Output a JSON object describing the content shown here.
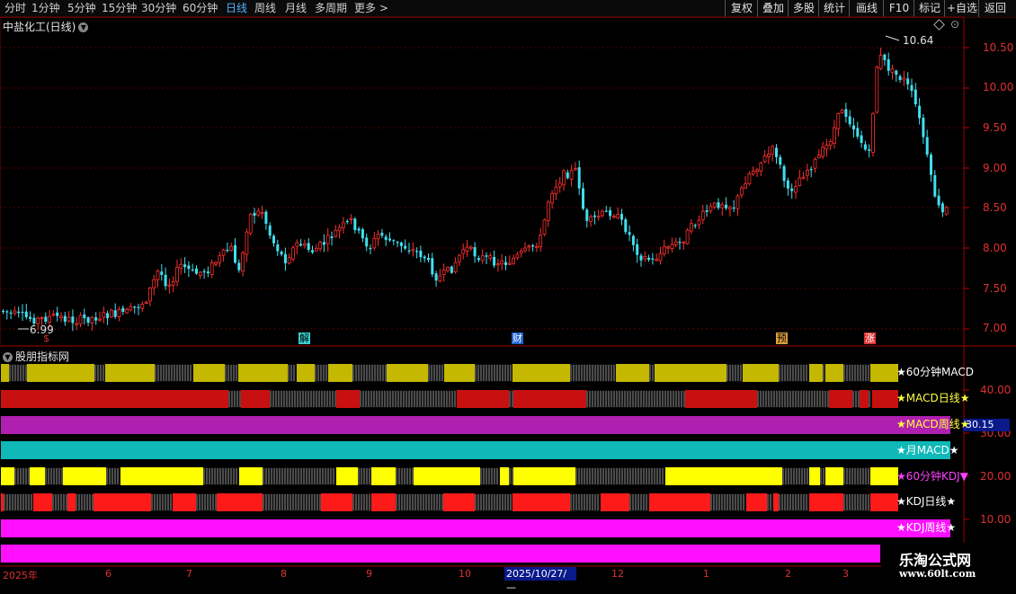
{
  "toolbar": {
    "timeframes": [
      "分时",
      "1分钟",
      "5分钟",
      "15分钟",
      "30分钟",
      "60分钟",
      "日线",
      "周线",
      "月线",
      "多周期",
      "更多 >"
    ],
    "active": "日线",
    "right_buttons": [
      "复权",
      "叠加",
      "多股",
      "统计",
      "画线",
      "F10",
      "标记",
      "+自选",
      "返回"
    ]
  },
  "chart": {
    "title": "中盐化工(日线)",
    "y_ticks": [
      "10.50",
      "10.00",
      "9.50",
      "9.00",
      "8.50",
      "8.00",
      "7.50",
      "7.00"
    ],
    "high_label": "10.64",
    "low_label": "6.99",
    "signals": [
      {
        "text": "$",
        "color": "#e03030",
        "bg": "transparent"
      },
      {
        "text": "解",
        "color": "#000",
        "bg": "#39d0d0"
      },
      {
        "text": "财",
        "color": "#fff",
        "bg": "#1e5fd0"
      },
      {
        "text": "预",
        "color": "#000",
        "bg": "#e0a040"
      },
      {
        "text": "涨",
        "color": "#fff",
        "bg": "#e03030"
      }
    ]
  },
  "indicator": {
    "title": "股朋指标网",
    "y_ticks": [
      "40.00",
      "30.00",
      "20.00",
      "10.00"
    ],
    "value_box": "30.15",
    "strips": [
      {
        "label": "★60分钟MACD",
        "color": "#c4b800",
        "label_color": "#ffffff"
      },
      {
        "label": "★MACD日线★",
        "color": "#c81010",
        "label_color": "#ffff40"
      },
      {
        "label": "★MACD周线★",
        "color": "#b020b0",
        "label_color": "#ffff40"
      },
      {
        "label": "★月MACD★",
        "color": "#10b8b8",
        "label_color": "#ffffff"
      },
      {
        "label": "★60分钟KDJ▼",
        "color": "#ffff00",
        "label_color": "#ff40ff"
      },
      {
        "label": "★KDJ日线★",
        "color": "#ff1a1a",
        "label_color": "#ffffff"
      },
      {
        "label": "★KDJ周线★",
        "color": "#ff10ff",
        "label_color": "#ffffff"
      },
      {
        "label": "",
        "color": "#ff10ff",
        "label_color": "#ffffff"
      }
    ]
  },
  "x_axis": {
    "labels": [
      "2025年",
      "6",
      "7",
      "8",
      "9",
      "10",
      "12",
      "1",
      "2",
      "3"
    ],
    "selected": "2025/10/27/—"
  },
  "watermark": {
    "title": "乐淘公式网",
    "url": "www.60lt.com"
  }
}
